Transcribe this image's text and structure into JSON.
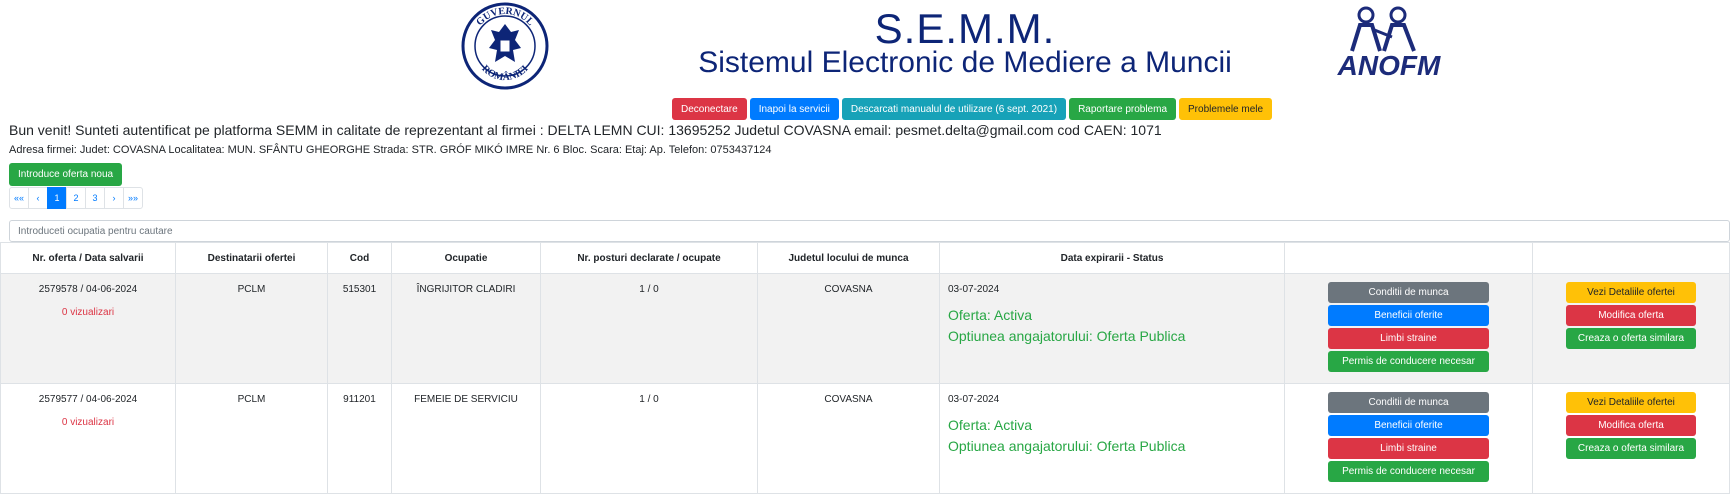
{
  "header": {
    "title": "S.E.M.M.",
    "subtitle": "Sistemul Electronic de Mediere a Muncii",
    "seal_text_top": "GUVERNUL",
    "seal_text_bottom": "ROMÂNIEI",
    "logo_text": "ANOFM"
  },
  "top_buttons": {
    "logout": "Deconectare",
    "back": "Inapoi la servicii",
    "manual": "Descarcati manualul de utilizare (6 sept. 2021)",
    "report": "Raportare problema",
    "my_problems": "Problemele mele"
  },
  "welcome": "Bun venit! Sunteti autentificat pe platforma SEMM  in calitate de reprezentant al firmei : DELTA LEMN CUI: 13695252 Judetul COVASNA email: pesmet.delta@gmail.com cod CAEN: 1071",
  "address": "Adresa firmei: Judet: COVASNA Localitatea: MUN. SFÂNTU GHEORGHE Strada: STR. GRÓF MIKÓ IMRE Nr. 6 Bloc. Scara: Etaj: Ap. Telefon: 0753437124",
  "new_offer_button": "Introduce oferta noua",
  "pagination": {
    "first": "««",
    "prev": "‹",
    "pages": [
      "1",
      "2",
      "3"
    ],
    "next": "›",
    "last": "»»",
    "active": "1"
  },
  "search": {
    "placeholder": "Introduceti ocupatia pentru cautare"
  },
  "table": {
    "columns": [
      "Nr. oferta / Data salvarii",
      "Destinatarii ofertei",
      "Cod",
      "Ocupatie",
      "Nr. posturi declarate / ocupate",
      "Judetul locului de munca",
      "Data expirarii - Status",
      "",
      ""
    ],
    "rows": [
      {
        "offer": "2579578 / 04-06-2024",
        "views": "0 vizualizari",
        "recipients": "PCLM",
        "code": "515301",
        "occupation": "ÎNGRIJITOR CLADIRI",
        "posts": "1 / 0",
        "county": "COVASNA",
        "expiry": "03-07-2024",
        "status": "Oferta: Activa",
        "option": "Optiunea angajatorului: Oferta Publica"
      },
      {
        "offer": "2579577 / 04-06-2024",
        "views": "0 vizualizari",
        "recipients": "PCLM",
        "code": "911201",
        "occupation": "FEMEIE DE SERVICIU",
        "posts": "1 / 0",
        "county": "COVASNA",
        "expiry": "03-07-2024",
        "status": "Oferta: Activa",
        "option": "Optiunea angajatorului: Oferta Publica"
      }
    ],
    "row_actions_a": {
      "conditions": "Conditii de munca",
      "benefits": "Beneficii oferite",
      "languages": "Limbi straine",
      "license": "Permis de conducere necesar"
    },
    "row_actions_b": {
      "details": "Vezi Detaliile ofertei",
      "modify": "Modifica oferta",
      "similar": "Creaza o oferta similara"
    }
  },
  "colors": {
    "title": "#0d2577",
    "danger": "#dc3545",
    "primary": "#007bff",
    "info": "#17a2b8",
    "success": "#28a745",
    "warning": "#ffc107",
    "secondary": "#6c757d"
  }
}
